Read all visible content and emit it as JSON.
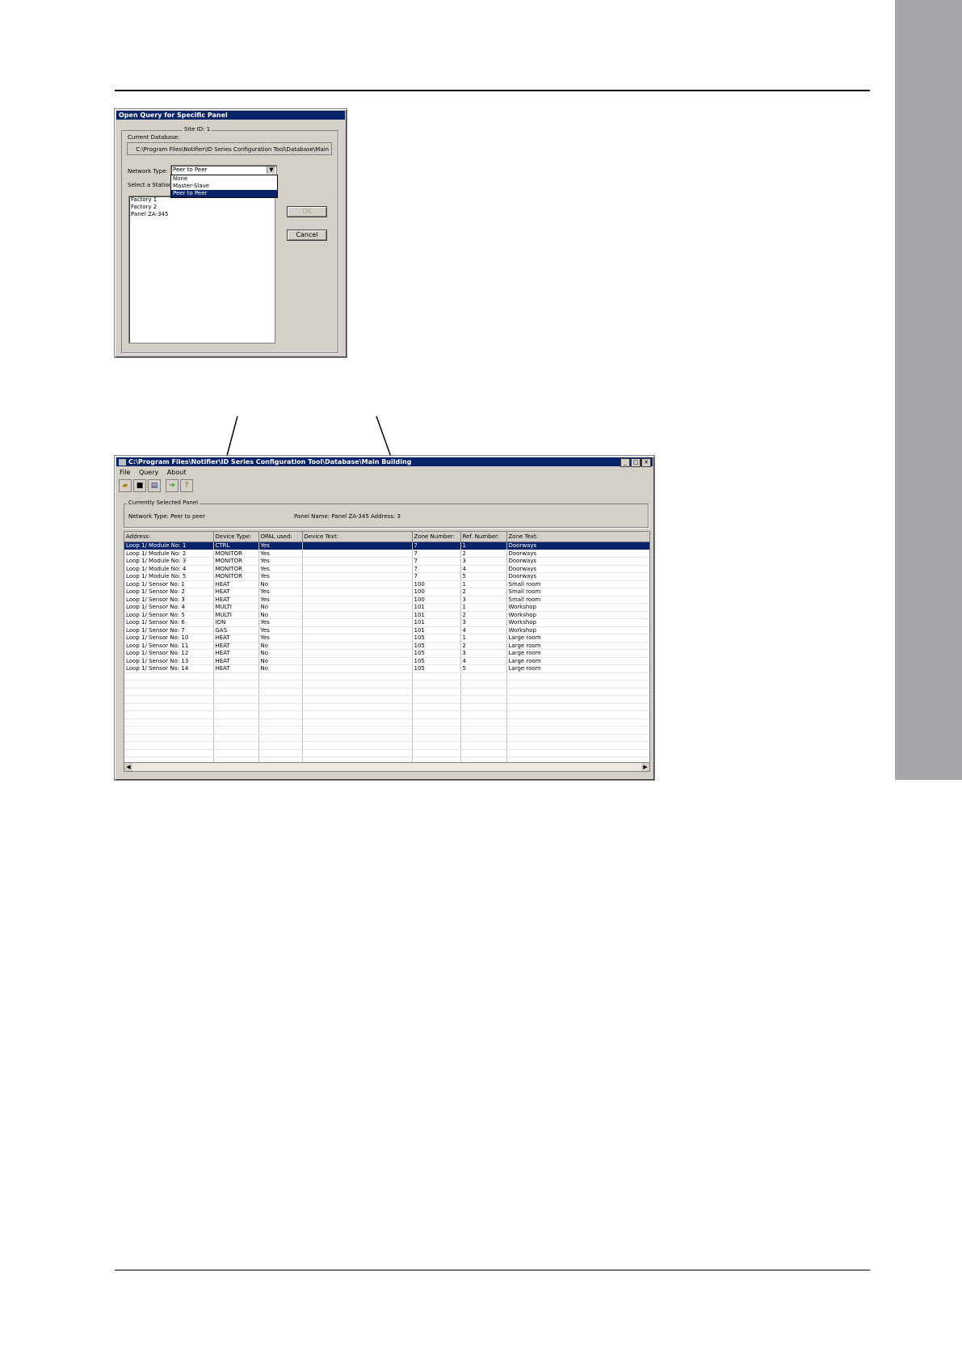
{
  "query_dialog": {
    "title": "Open Query for Specific Panel",
    "site_id": "Site ID: 1",
    "current_db_label": "Current Database:",
    "current_db_path": "C:\\Program Files\\Notifier\\ID Series Configuration Tool\\Database\\Main",
    "network_type_label": "Network Type:",
    "network_type_value": "Peer to Peer",
    "network_options": [
      "None",
      "Master-Slave",
      "Peer to Peer"
    ],
    "select_station_label": "Select a Station",
    "stations": [
      "Factory 1",
      "Factory 2",
      "Panel ZA-345"
    ],
    "ok_label": "OK",
    "cancel_label": "Cancel"
  },
  "main_window": {
    "title": "C:\\Program Files\\Notifier\\ID Series Configuration Tool\\Database\\Main Building",
    "menu": [
      "File",
      "Query",
      "About"
    ],
    "toolbar_icons": [
      "open-folder-icon",
      "save-disk-icon",
      "print-icon",
      "export-icon",
      "help-key-icon"
    ],
    "selected_panel": {
      "group_label": "Currently Selected Panel",
      "network_type": "Network Type: Peer to peer",
      "panel_info": "Panel Name: Panel ZA-345 Address: 3"
    },
    "table": {
      "columns": [
        "Address:",
        "Device Type:",
        "OPAL used:",
        "Device Text:",
        "Zone Number:",
        "Ref. Number:",
        "Zone Text:"
      ],
      "rows": [
        [
          "Loop 1/ Module No: 1",
          "CTRL",
          "Yes",
          "",
          "7",
          "1",
          "Doorways"
        ],
        [
          "Loop 1/ Module No: 2",
          "MONITOR",
          "Yes",
          "",
          "7",
          "2",
          "Doorways"
        ],
        [
          "Loop 1/ Module No: 3",
          "MONITOR",
          "Yes",
          "",
          "7",
          "3",
          "Doorways"
        ],
        [
          "Loop 1/ Module No: 4",
          "MONITOR",
          "Yes",
          "",
          "7",
          "4",
          "Doorways"
        ],
        [
          "Loop 1/ Module No: 5",
          "MONITOR",
          "Yes",
          "",
          "7",
          "5",
          "Doorways"
        ],
        [
          "Loop 1/ Sensor No: 1",
          "HEAT",
          "No",
          "",
          "100",
          "1",
          "Small room"
        ],
        [
          "Loop 1/ Sensor No: 2",
          "HEAT",
          "Yes",
          "",
          "100",
          "2",
          "Small room"
        ],
        [
          "Loop 1/ Sensor No: 3",
          "HEAT",
          "Yes",
          "",
          "100",
          "3",
          "Small room"
        ],
        [
          "Loop 1/ Sensor No: 4",
          "MULTI",
          "No",
          "",
          "101",
          "1",
          "Workshop"
        ],
        [
          "Loop 1/ Sensor No: 5",
          "MULTI",
          "No",
          "",
          "101",
          "2",
          "Workshop"
        ],
        [
          "Loop 1/ Sensor No: 6",
          "ION",
          "Yes",
          "",
          "101",
          "3",
          "Workshop"
        ],
        [
          "Loop 1/ Sensor No: 7",
          "GAS",
          "Yes",
          "",
          "101",
          "4",
          "Workshop"
        ],
        [
          "Loop 1/ Sensor No: 10",
          "HEAT",
          "Yes",
          "",
          "105",
          "1",
          "Large room"
        ],
        [
          "Loop 1/ Sensor No: 11",
          "HEAT",
          "No",
          "",
          "105",
          "2",
          "Large room"
        ],
        [
          "Loop 1/ Sensor No: 12",
          "HEAT",
          "No",
          "",
          "105",
          "3",
          "Large room"
        ],
        [
          "Loop 1/ Sensor No: 13",
          "HEAT",
          "No",
          "",
          "105",
          "4",
          "Large room"
        ],
        [
          "Loop 1/ Sensor No: 14",
          "HEAT",
          "No",
          "",
          "105",
          "5",
          "Large room"
        ]
      ],
      "selected_row": 0,
      "empty_rows": 12
    }
  }
}
